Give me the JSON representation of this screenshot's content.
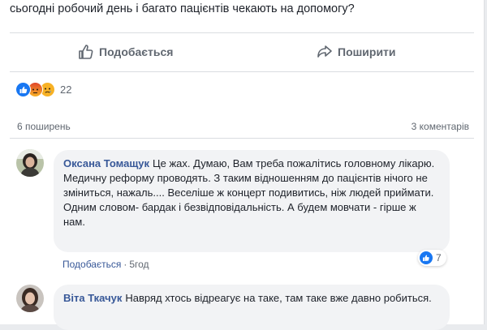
{
  "post": {
    "text_tail": "сьогодні робочий день і багато пацієнтів чекають на допомогу?"
  },
  "actions": {
    "like_label": "Подобається",
    "share_label": "Поширити"
  },
  "reactions": {
    "count": "22",
    "types": [
      "like-icon",
      "angry-icon",
      "sad-icon"
    ],
    "colors": {
      "like": "#1877f2",
      "angry": "#e9710f",
      "sad": "#f7b125"
    }
  },
  "stats": {
    "shares": "6 поширень",
    "comments": "3 коментарів"
  },
  "comments": [
    {
      "author": "Оксана Томащук",
      "text": "Це жах. Думаю, Вам треба пожалітись головному лікарю. Медичну реформу проводять. З таким відношенням до пацієнтів нічого не зміниться, нажаль.... Веселіше ж концерт подивитись, ніж людей приймати. Одним словом- бардак і безвідповідальність. А будем мовчати - гірше ж нам.",
      "like_label": "Подобається",
      "separator": "·",
      "time": "5год",
      "likes": "7"
    },
    {
      "author": "Віта Ткачук",
      "text": "Навряд хтось відреагує на таке, там таке вже давно робиться."
    }
  ],
  "theme": {
    "link": "#385898",
    "muted": "#606770",
    "bubble": "#f2f3f5"
  }
}
